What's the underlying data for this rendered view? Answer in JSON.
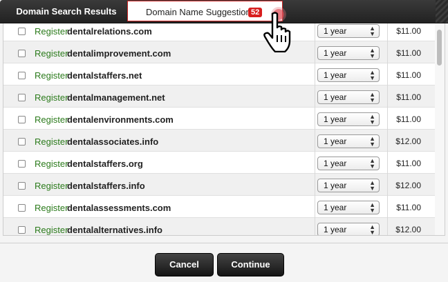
{
  "tabs": [
    {
      "label": "Domain Search Results"
    },
    {
      "label": "Domain Name Suggestions",
      "badge": "52"
    }
  ],
  "register_label": "Register",
  "rows": [
    {
      "domain": "dentalrelations.com",
      "term": "1 year",
      "price": "$11.00"
    },
    {
      "domain": "dentalimprovement.com",
      "term": "1 year",
      "price": "$11.00"
    },
    {
      "domain": "dentalstaffers.net",
      "term": "1 year",
      "price": "$11.00"
    },
    {
      "domain": "dentalmanagement.net",
      "term": "1 year",
      "price": "$11.00"
    },
    {
      "domain": "dentalenvironments.com",
      "term": "1 year",
      "price": "$11.00"
    },
    {
      "domain": "dentalassociates.info",
      "term": "1 year",
      "price": "$12.00"
    },
    {
      "domain": "dentalstaffers.org",
      "term": "1 year",
      "price": "$11.00"
    },
    {
      "domain": "dentalstaffers.info",
      "term": "1 year",
      "price": "$12.00"
    },
    {
      "domain": "dentalassessments.com",
      "term": "1 year",
      "price": "$11.00"
    },
    {
      "domain": "dentalalternatives.info",
      "term": "1 year",
      "price": "$12.00"
    }
  ],
  "buttons": {
    "cancel": "Cancel",
    "continue": "Continue"
  },
  "colors": {
    "register_green": "#2a7a1a",
    "badge_red": "#d81e1e"
  }
}
